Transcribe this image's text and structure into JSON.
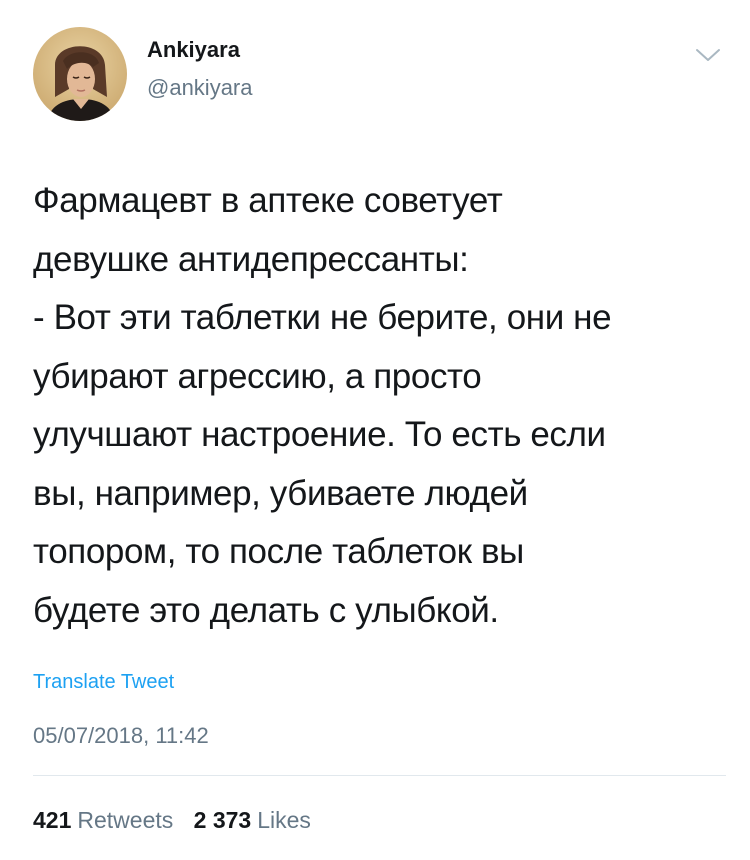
{
  "author": {
    "display_name": "Ankiyara",
    "handle": "@ankiyara"
  },
  "menu_icon": "chevron-down-icon",
  "tweet": {
    "text": "Фармацевт в аптеке советует\nдевушке антидепрессанты:\n- Вот эти таблетки не берите, они не\nубирают агрессию, а просто\nулучшают настроение. То есть если\nвы, например, убиваете людей\nтопором, то после таблеток вы\nбудете это делать с улыбкой.",
    "translate_label": "Translate Tweet",
    "timestamp": "05/07/2018, 11:42"
  },
  "stats": {
    "retweets_count": "421",
    "retweets_label": "Retweets",
    "likes_count": "2 373",
    "likes_label": "Likes"
  },
  "colors": {
    "link": "#1da1f2",
    "secondary_text": "#657786",
    "primary_text": "#14171a",
    "divider": "#e1e8ed"
  }
}
